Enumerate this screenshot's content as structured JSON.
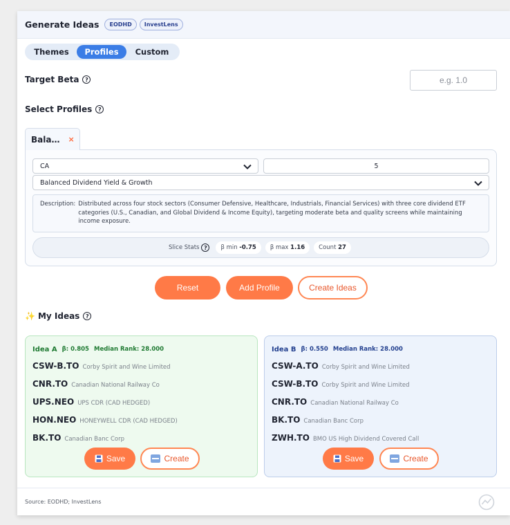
{
  "header": {
    "title": "Generate Ideas",
    "badges": [
      "EODHD",
      "InvestLens"
    ]
  },
  "tabs": [
    {
      "label": "Themes",
      "active": false
    },
    {
      "label": "Profiles",
      "active": true
    },
    {
      "label": "Custom",
      "active": false
    }
  ],
  "target_beta": {
    "label": "Target Beta",
    "help_icon": "question-circle-icon",
    "placeholder": "e.g. 1.0",
    "value": ""
  },
  "select_profiles": {
    "label": "Select Profiles"
  },
  "profile_tab": {
    "label": "Bala…",
    "close": "×"
  },
  "profile": {
    "region": "CA",
    "count": "5",
    "name": "Balanced Dividend Yield & Growth",
    "description_label": "Description:",
    "description": "Distributed across four stock sectors (Consumer Defensive, Healthcare, Industrials, Financial Services) with three core dividend ETF categories (U.S., Canadian, and Global Dividend & Income Equity), targeting moderate beta and quality screens while maintaining income exposure.",
    "stats": {
      "label": "Slice Stats",
      "beta_min_label": "β min",
      "beta_min": "-0.75",
      "beta_max_label": "β max",
      "beta_max": "1.16",
      "count_label": "Count",
      "count": "27"
    }
  },
  "actions": {
    "reset": "Reset",
    "add_profile": "Add Profile",
    "create_ideas": "Create Ideas"
  },
  "my_ideas": {
    "emoji": "✨",
    "label": "My Ideas"
  },
  "ideas": [
    {
      "id": "Idea A",
      "beta": "β: 0.805",
      "median_rank": "Median Rank: 28.000",
      "holdings": [
        {
          "ticker": "CSW-B.TO",
          "name": "Corby Spirit and Wine Limited"
        },
        {
          "ticker": "CNR.TO",
          "name": "Canadian National Railway Co"
        },
        {
          "ticker": "UPS.NEO",
          "name": "UPS CDR (CAD HEDGED)"
        },
        {
          "ticker": "HON.NEO",
          "name": "HONEYWELL CDR (CAD HEDGED)"
        },
        {
          "ticker": "BK.TO",
          "name": "Canadian Banc Corp"
        }
      ],
      "save": "Save",
      "create": "Create"
    },
    {
      "id": "Idea B",
      "beta": "β: 0.550",
      "median_rank": "Median Rank: 28.000",
      "holdings": [
        {
          "ticker": "CSW-A.TO",
          "name": "Corby Spirit and Wine Limited"
        },
        {
          "ticker": "CSW-B.TO",
          "name": "Corby Spirit and Wine Limited"
        },
        {
          "ticker": "CNR.TO",
          "name": "Canadian National Railway Co"
        },
        {
          "ticker": "BK.TO",
          "name": "Canadian Banc Corp"
        },
        {
          "ticker": "ZWH.TO",
          "name": "BMO US High Dividend Covered Call"
        }
      ],
      "save": "Save",
      "create": "Create"
    }
  ],
  "footer": {
    "source": "Source: EODHD; InvestLens"
  },
  "colors": {
    "accent": "#ff7a47",
    "tab_active": "#3b7de6",
    "idea_a_bg": "#eefaef",
    "idea_b_bg": "#edf3fc"
  }
}
